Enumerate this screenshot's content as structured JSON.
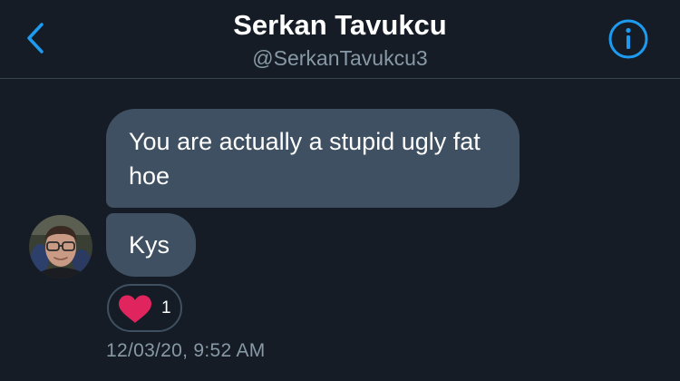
{
  "header": {
    "title": "Serkan Tavukcu",
    "handle": "@SerkanTavukcu3",
    "back_icon": "chevron-left-icon",
    "info_icon": "info-circle-icon"
  },
  "messages": [
    {
      "text": "You are actually a stupid ugly fat hoe",
      "sender": "them"
    },
    {
      "text": "Kys",
      "sender": "them"
    }
  ],
  "reaction": {
    "icon": "heart-icon",
    "count": "1"
  },
  "timestamp": "12/03/20, 9:52 AM",
  "colors": {
    "background": "#151c26",
    "bubble": "#3e5061",
    "accent": "#1d9bf0",
    "secondary_text": "#8899a6",
    "heart": "#e0245e"
  }
}
